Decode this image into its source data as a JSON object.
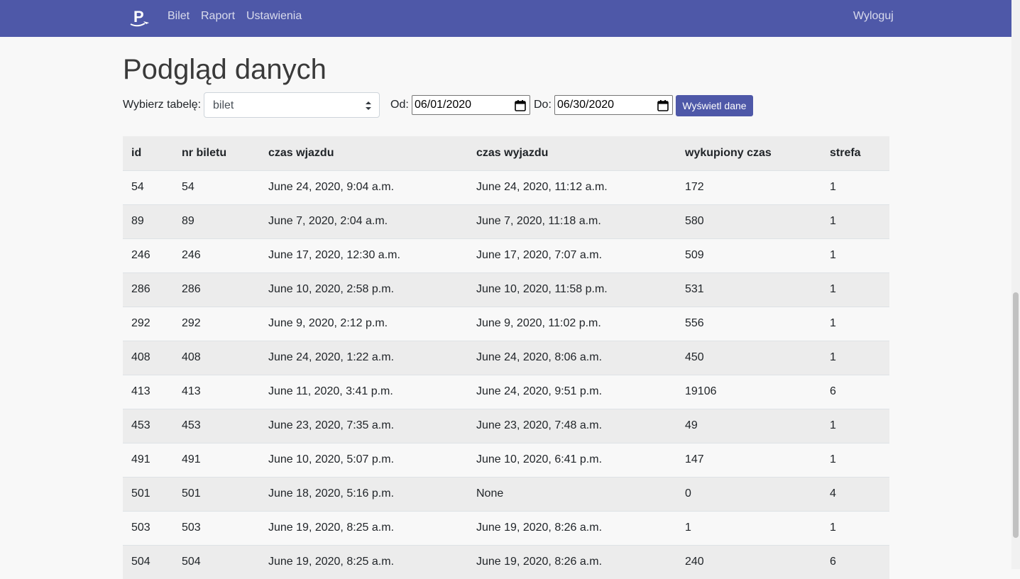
{
  "navbar": {
    "brand_icon": "parking-plane-logo-icon",
    "links": [
      "Bilet",
      "Raport",
      "Ustawienia"
    ],
    "logout_label": "Wyloguj",
    "background": "#4e58a8"
  },
  "page": {
    "title": "Podgląd danych"
  },
  "filters": {
    "table_label": "Wybierz tabelę:",
    "table_selected": "bilet",
    "from_label": "Od:",
    "from_value": "06/01/2020",
    "to_label": "Do:",
    "to_value": "06/30/2020",
    "submit_label": "Wyświetl dane"
  },
  "table": {
    "columns": [
      "id",
      "nr biletu",
      "czas wjazdu",
      "czas wyjazdu",
      "wykupiony czas",
      "strefa"
    ],
    "rows": [
      [
        "54",
        "54",
        "June 24, 2020, 9:04 a.m.",
        "June 24, 2020, 11:12 a.m.",
        "172",
        "1"
      ],
      [
        "89",
        "89",
        "June 7, 2020, 2:04 a.m.",
        "June 7, 2020, 11:18 a.m.",
        "580",
        "1"
      ],
      [
        "246",
        "246",
        "June 17, 2020, 12:30 a.m.",
        "June 17, 2020, 7:07 a.m.",
        "509",
        "1"
      ],
      [
        "286",
        "286",
        "June 10, 2020, 2:58 p.m.",
        "June 10, 2020, 11:58 p.m.",
        "531",
        "1"
      ],
      [
        "292",
        "292",
        "June 9, 2020, 2:12 p.m.",
        "June 9, 2020, 11:02 p.m.",
        "556",
        "1"
      ],
      [
        "408",
        "408",
        "June 24, 2020, 1:22 a.m.",
        "June 24, 2020, 8:06 a.m.",
        "450",
        "1"
      ],
      [
        "413",
        "413",
        "June 11, 2020, 3:41 p.m.",
        "June 24, 2020, 9:51 p.m.",
        "19106",
        "6"
      ],
      [
        "453",
        "453",
        "June 23, 2020, 7:35 a.m.",
        "June 23, 2020, 7:48 a.m.",
        "49",
        "1"
      ],
      [
        "491",
        "491",
        "June 10, 2020, 5:07 p.m.",
        "June 10, 2020, 6:41 p.m.",
        "147",
        "1"
      ],
      [
        "501",
        "501",
        "June 18, 2020, 5:16 p.m.",
        "None",
        "0",
        "4"
      ],
      [
        "503",
        "503",
        "June 19, 2020, 8:25 a.m.",
        "June 19, 2020, 8:26 a.m.",
        "1",
        "1"
      ],
      [
        "504",
        "504",
        "June 19, 2020, 8:25 a.m.",
        "June 19, 2020, 8:26 a.m.",
        "240",
        "6"
      ]
    ]
  }
}
